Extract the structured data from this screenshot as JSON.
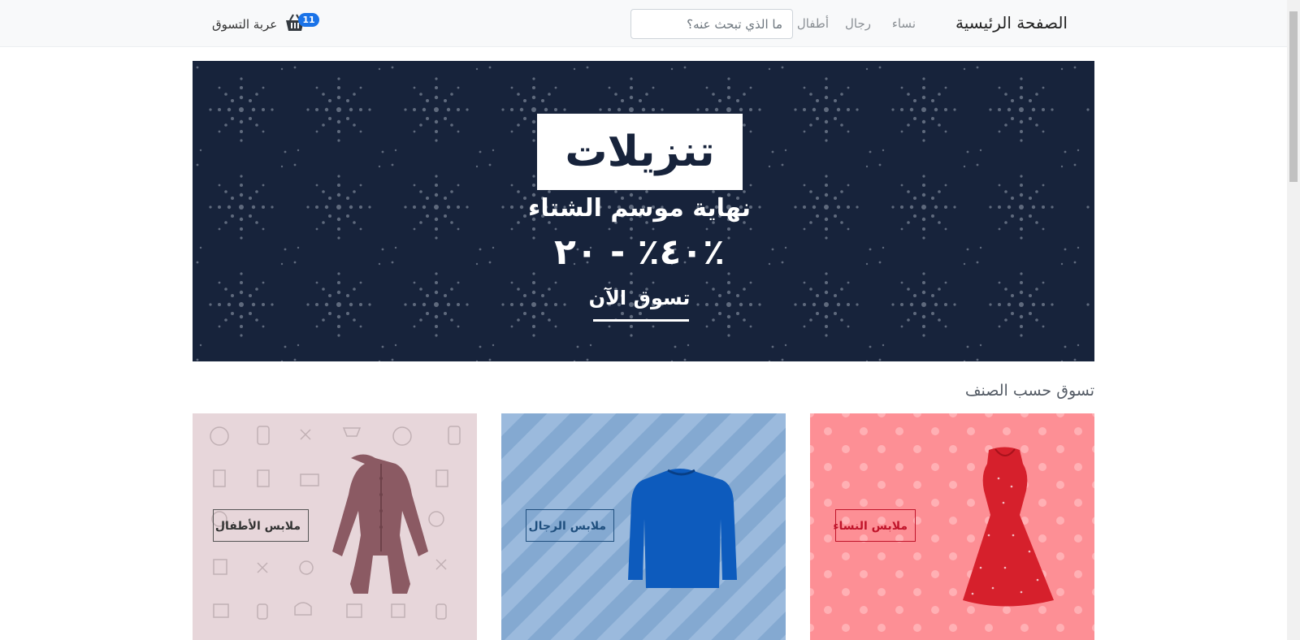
{
  "navbar": {
    "brand": "الصفحة الرئيسية",
    "links": [
      "نساء",
      "رجال",
      "أطفال"
    ],
    "search_placeholder": "ما الذي تبحث عنه؟",
    "cart_label": "عربة التسوق",
    "cart_count": "11",
    "cart_icon": "basket-icon"
  },
  "hero": {
    "title": "تنزيلات",
    "subtitle": "نهاية موسم الشتاء",
    "percent": "٤٠٪ - ٢٠٪",
    "cta": "تسوق الآن",
    "background_color": "#17233b"
  },
  "section": {
    "title": "تسوق حسب الصنف"
  },
  "categories": [
    {
      "label": "ملابس النساء",
      "color": "#fd8f95",
      "image": "red-dress"
    },
    {
      "label": "ملابس الرجال",
      "color": "#84a9d1",
      "image": "blue-sweater"
    },
    {
      "label": "ملابس الأطفال",
      "color": "#e7d6da",
      "image": "baby-onesie"
    }
  ]
}
